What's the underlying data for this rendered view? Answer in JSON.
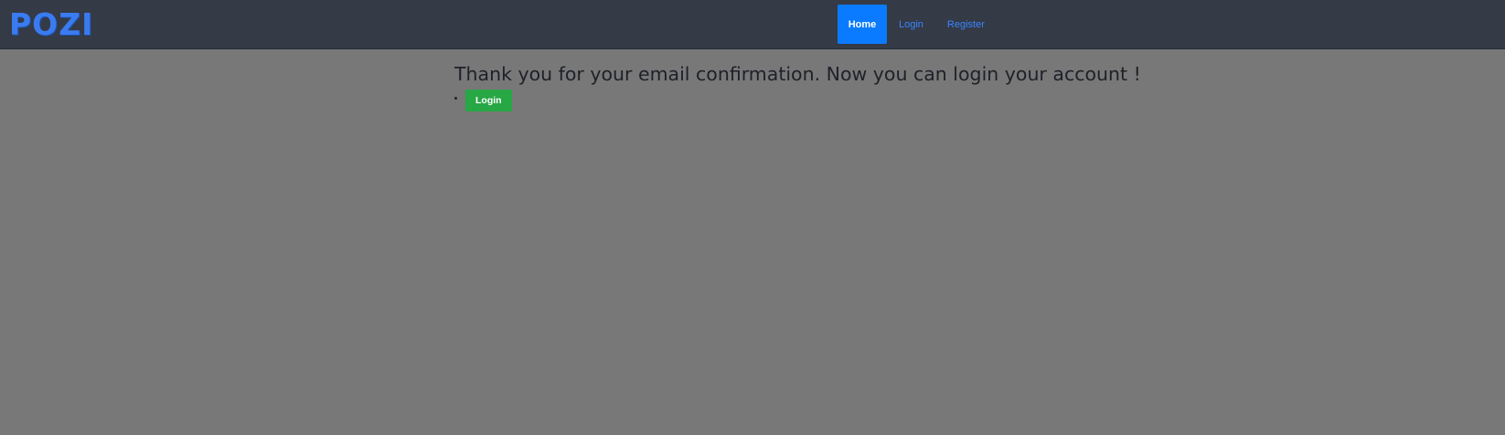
{
  "brand": {
    "logo_text": "POZI"
  },
  "nav": {
    "items": [
      {
        "label": "Home",
        "active": true
      },
      {
        "label": "Login",
        "active": false
      },
      {
        "label": "Register",
        "active": false
      }
    ]
  },
  "main": {
    "message": "Thank you for your email confirmation. Now you can login your account !",
    "login_button_label": "Login"
  },
  "colors": {
    "navbar_bg": "#343a46",
    "page_bg": "#787878",
    "brand": "#3b7bf0",
    "active_nav": "#0a7bff",
    "nav_link": "#3a86ff",
    "login_button": "#28a745"
  }
}
